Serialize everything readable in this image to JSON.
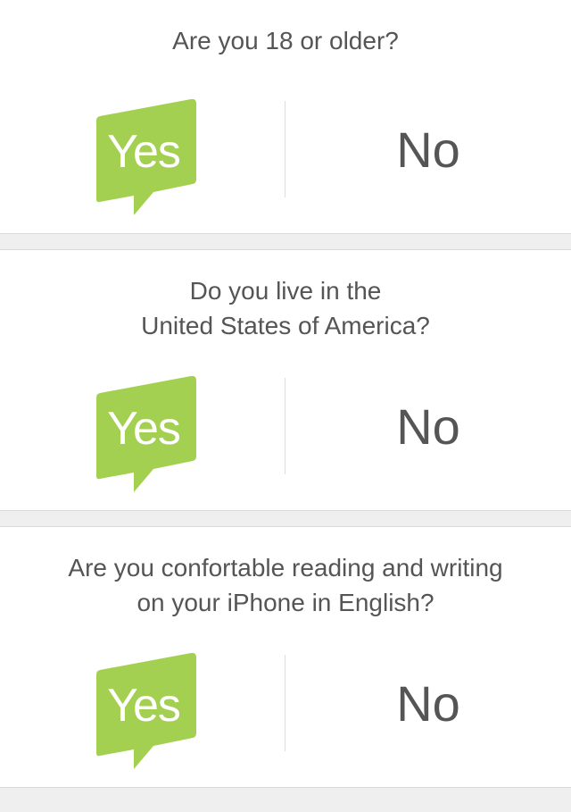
{
  "theme": {
    "accent": "#a4d052",
    "text": "#555555",
    "background": "#efefef",
    "card": "#ffffff"
  },
  "questions": [
    {
      "lines": [
        "Are you 18 or older?"
      ],
      "yes_label": "Yes",
      "no_label": "No"
    },
    {
      "lines": [
        "Do you live in the",
        "United States of America?"
      ],
      "yes_label": "Yes",
      "no_label": "No"
    },
    {
      "lines": [
        "Are you confortable reading and writing",
        "on your iPhone in English?"
      ],
      "yes_label": "Yes",
      "no_label": "No"
    }
  ]
}
